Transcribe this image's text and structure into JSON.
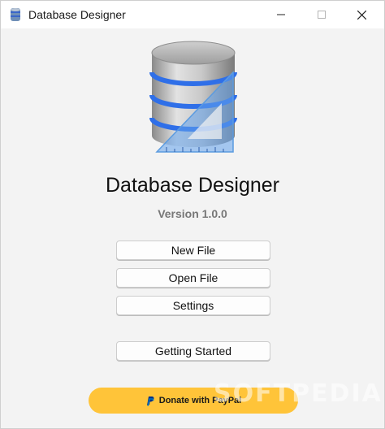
{
  "window": {
    "title": "Database Designer"
  },
  "main": {
    "app_name": "Database Designer",
    "version": "Version 1.0.0"
  },
  "buttons": {
    "new_file": "New File",
    "open_file": "Open File",
    "settings": "Settings",
    "getting_started": "Getting Started"
  },
  "donate": {
    "label": "Donate with PayPal"
  },
  "watermark": {
    "text": "SOFTPEDIA"
  },
  "colors": {
    "donate_bg": "#ffc439",
    "logo_accent": "#3b82f6"
  }
}
